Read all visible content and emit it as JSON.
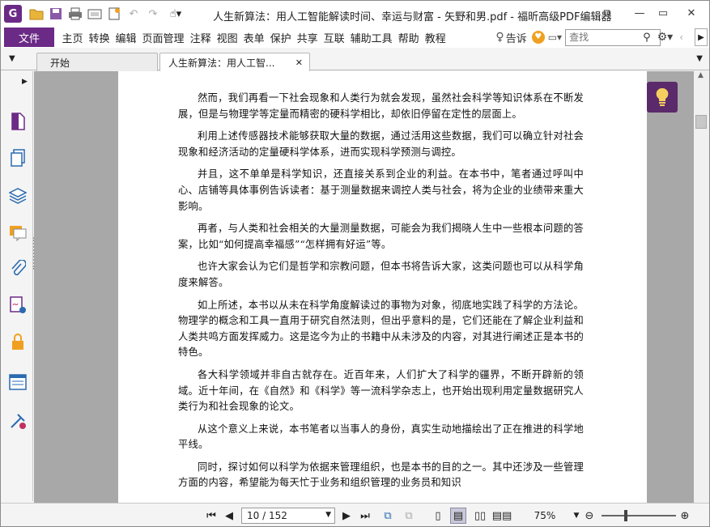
{
  "titlebar": {
    "title": "人生新算法：用人工智能解读时间、幸运与财富 - 矢野和男.pdf - 福昕高级PDF编辑器",
    "app_logo": "G",
    "quick_icons": [
      "open-folder-icon",
      "save-icon",
      "print-icon",
      "scan-icon",
      "new-icon",
      "undo-icon",
      "redo-icon",
      "hand-tool-icon"
    ]
  },
  "menubar": {
    "file": "文件",
    "items": [
      "主页",
      "转换",
      "编辑",
      "页面管理",
      "注释",
      "视图",
      "表单",
      "保护",
      "共享",
      "互联",
      "辅助工具",
      "帮助",
      "教程"
    ],
    "tell": "告诉",
    "search_placeholder": "查找"
  },
  "tabs": [
    {
      "label": "开始"
    },
    {
      "label": "人生新算法：用人工智..."
    }
  ],
  "document": {
    "paragraphs": [
      "然而，我们再看一下社会现象和人类行为就会发现，虽然社会科学等知识体系在不断发展，但是与物理学等定量而精密的硬科学相比，却依旧停留在定性的层面上。",
      "利用上述传感器技术能够获取大量的数据，通过活用这些数据，我们可以确立针对社会现象和经济活动的定量硬科学体系，进而实现科学预测与调控。",
      "并且，这不单单是科学知识，还直接关系到企业的利益。在本书中，笔者通过呼叫中心、店铺等具体事例告诉读者：基于测量数据来调控人类与社会，将为企业的业绩带来重大影响。",
      "再者，与人类和社会相关的大量测量数据，可能会为我们揭晓人生中一些根本问题的答案，比如“如何提高幸福感”“怎样拥有好运”等。",
      "也许大家会认为它们是哲学和宗教问题，但本书将告诉大家，这类问题也可以从科学角度来解答。",
      "如上所述，本书以从未在科学角度解读过的事物为对象，彻底地实践了科学的方法论。物理学的概念和工具一直用于研究自然法则，但出乎意料的是，它们还能在了解企业利益和人类共鸣方面发挥威力。这是迄今为止的书籍中从未涉及的内容，对其进行阐述正是本书的特色。",
      "各大科学领域并非自古就存在。近百年来，人们扩大了科学的疆界，不断开辟新的领域。近十年间，在《自然》和《科学》等一流科学杂志上，也开始出现利用定量数据研究人类行为和社会现象的论文。",
      "从这个意义上来说，本书笔者以当事人的身份，真实生动地描绘出了正在推进的科学地平线。",
      "同时，探讨如何以科学为依据来管理组织，也是本书的目的之一。其中还涉及一些管理方面的内容，希望能为每天忙于业务和组织管理的业务员和知识"
    ]
  },
  "statusbar": {
    "page_display": "10 / 152",
    "zoom": "75%"
  },
  "colors": {
    "accent": "#6b2a86",
    "bulb_bg": "#5b2a6a",
    "doc_bg": "#a8a8a8"
  }
}
